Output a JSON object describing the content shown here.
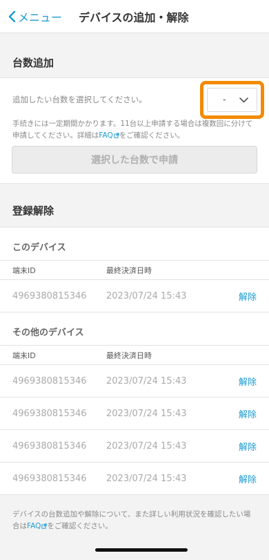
{
  "nav": {
    "back_label": "メニュー",
    "title": "デバイスの追加・解除"
  },
  "add": {
    "section_title": "台数追加",
    "prompt": "追加したい台数を選択してください。",
    "selected_value": "-",
    "note_before": "手続きには一定期間かかります。11台以上申請する場合は複数回に分けて申請してください。詳細は",
    "faq_label": "FAQ",
    "note_after": "をご確認ください。",
    "apply_button": "選択した台数で申請"
  },
  "remove": {
    "section_title": "登録解除",
    "this_device": {
      "title": "このデバイス",
      "col_id": "端末ID",
      "col_date": "最終決済日時",
      "rows": [
        {
          "id": "4969380815346",
          "date": "2023/07/24 15:43",
          "action": "解除"
        }
      ]
    },
    "other_devices": {
      "title": "その他のデバイス",
      "col_id": "端末ID",
      "col_date": "最終決済日時",
      "rows": [
        {
          "id": "4969380815346",
          "date": "2023/07/24 15:43",
          "action": "解除"
        },
        {
          "id": "4969380815346",
          "date": "2023/07/24 15:43",
          "action": "解除"
        },
        {
          "id": "4969380815346",
          "date": "2023/07/24 15:43",
          "action": "解除"
        },
        {
          "id": "4969380815346",
          "date": "2023/07/24 15:43",
          "action": "解除"
        }
      ]
    }
  },
  "footer": {
    "text_before": "デバイスの台数追加や解除について、また詳しい利用状況を確認したい場合は",
    "faq_label": "FAQ",
    "text_after": "をご確認ください。"
  },
  "colors": {
    "accent": "#1a9bd1",
    "highlight": "#f28b00"
  },
  "icons": {
    "back": "chevron-left-icon",
    "select": "chevron-down-icon",
    "external": "external-link-icon"
  }
}
